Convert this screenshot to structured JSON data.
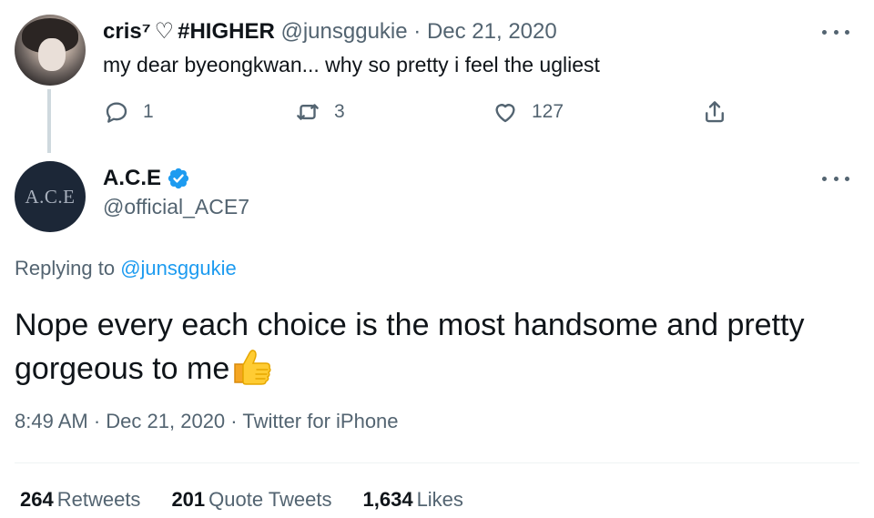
{
  "parent_tweet": {
    "display_name": "cris⁷",
    "heart": "♡",
    "name_suffix": "#HIGHER",
    "handle": "@junsggukie",
    "separator": "·",
    "date": "Dec 21, 2020",
    "text": "my dear byeongkwan... why so pretty i feel the ugliest",
    "actions": {
      "reply_count": "1",
      "retweet_count": "3",
      "like_count": "127"
    }
  },
  "main_tweet": {
    "avatar_text": "A.C.E",
    "display_name": "A.C.E",
    "verified": true,
    "handle": "@official_ACE7",
    "replying_prefix": "Replying to",
    "replying_to": "@junsggukie",
    "text": "Nope every each choice is the most handsome and pretty gorgeous to me",
    "emoji": "thumbs-up",
    "time": "8:49 AM",
    "date": "Dec 21, 2020",
    "source": "Twitter for iPhone",
    "separator": "·"
  },
  "stats": {
    "retweets_count": "264",
    "retweets_label": "Retweets",
    "quote_count": "201",
    "quote_label": "Quote Tweets",
    "likes_count": "1,634",
    "likes_label": "Likes"
  },
  "colors": {
    "text_primary": "#0f1419",
    "text_secondary": "#536471",
    "link": "#1d9bf0",
    "verified": "#1d9bf0",
    "divider": "#eff3f4",
    "thread_line": "#cfd9de"
  }
}
